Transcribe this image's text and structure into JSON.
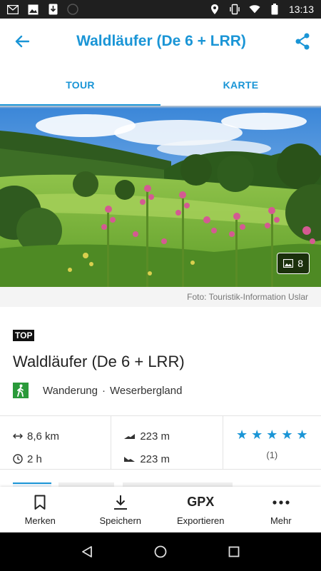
{
  "status_bar": {
    "time": "13:13"
  },
  "header": {
    "title": "Waldläufer (De 6 + LRR)"
  },
  "tabs": [
    {
      "label": "TOUR",
      "active": true
    },
    {
      "label": "KARTE",
      "active": false
    }
  ],
  "hero": {
    "photo_count": "8"
  },
  "caption": "Foto: Touristik-Information Uslar",
  "tour": {
    "badge": "TOP",
    "title": "Waldläufer (De 6 + LRR)",
    "category": "Wanderung",
    "region": "Weserbergland"
  },
  "stats": {
    "distance": "8,6 km",
    "duration": "2 h",
    "ascent": "223 m",
    "descent": "223 m",
    "rating": 5,
    "rating_count": "(1)"
  },
  "actions": [
    {
      "label": "Merken",
      "icon": "bookmark-icon"
    },
    {
      "label": "Speichern",
      "icon": "download-icon"
    },
    {
      "label": "Exportieren",
      "icon_text": "GPX"
    },
    {
      "label": "Mehr",
      "icon": "more-icon"
    }
  ],
  "colors": {
    "accent": "#1a95d6",
    "hiking": "#2a9a3a"
  }
}
